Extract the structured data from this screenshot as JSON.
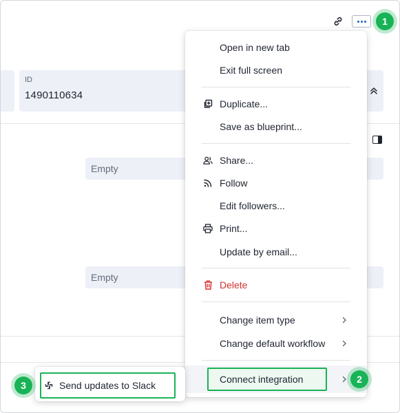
{
  "record": {
    "id_label": "ID",
    "id_value": "1490110634",
    "empty_1": "Empty",
    "empty_2": "Empty"
  },
  "badges": [
    "1",
    "2",
    "3"
  ],
  "menu": {
    "items": [
      {
        "label": "Open in new tab",
        "icon": ""
      },
      {
        "label": "Exit full screen",
        "icon": ""
      },
      {
        "label": "Duplicate...",
        "icon": "duplicate-icon"
      },
      {
        "label": "Save as blueprint...",
        "icon": ""
      },
      {
        "label": "Share...",
        "icon": "share-people-icon"
      },
      {
        "label": "Follow",
        "icon": "rss-follow-icon"
      },
      {
        "label": "Edit followers...",
        "icon": ""
      },
      {
        "label": "Print...",
        "icon": "printer-icon"
      },
      {
        "label": "Update by email...",
        "icon": ""
      },
      {
        "label": "Delete",
        "icon": "trash-icon"
      },
      {
        "label": "Change item type",
        "icon": "chevron-right-icon"
      },
      {
        "label": "Change default workflow",
        "icon": "chevron-right-icon"
      },
      {
        "label": "Connect integration",
        "icon": "chevron-right-icon"
      }
    ]
  },
  "submenu": {
    "items": [
      {
        "label": "Send updates to Slack",
        "icon": "slack-icon"
      }
    ]
  },
  "colors": {
    "accent": "#1565c0",
    "highlight": "#19b357",
    "danger": "#d32f2f",
    "field_bg": "#edf0f7"
  }
}
